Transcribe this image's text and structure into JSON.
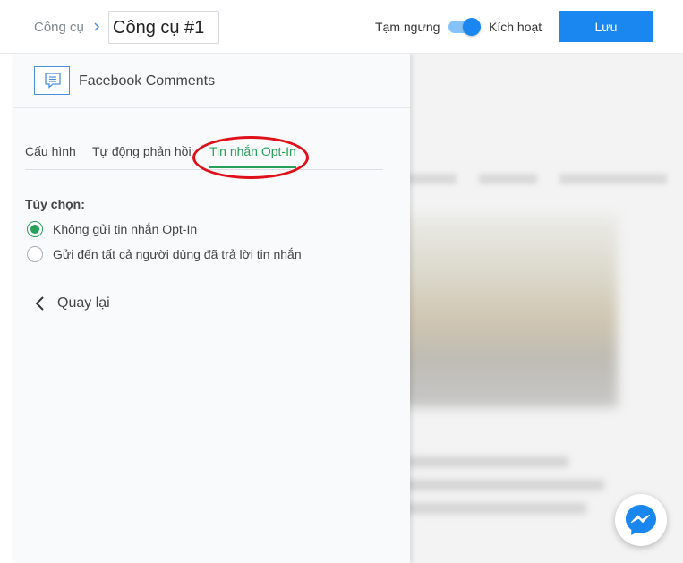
{
  "header": {
    "breadcrumb": "Công cụ",
    "tool_name": "Công cụ #1",
    "pause_label": "Tạm ngưng",
    "activate_label": "Kích hoạt",
    "toggle_on": true,
    "save_label": "Lưu"
  },
  "panel": {
    "icon": "comment-icon",
    "title": "Facebook Comments",
    "tabs": [
      {
        "label": "Cấu hình",
        "active": false
      },
      {
        "label": "Tự động phản hồi",
        "active": false
      },
      {
        "label": "Tin nhắn Opt-In",
        "active": true
      }
    ],
    "options_label": "Tùy chọn:",
    "options": [
      {
        "label": "Không gửi tin nhắn Opt-In",
        "selected": true
      },
      {
        "label": "Gửi đến tất cả người dùng đã trả lời tin nhắn",
        "selected": false
      }
    ],
    "back_label": "Quay lại"
  },
  "colors": {
    "primary": "#1a86f0",
    "accent_green": "#27a157",
    "highlight_red": "#e0101a"
  },
  "widget": {
    "icon": "messenger-icon"
  }
}
